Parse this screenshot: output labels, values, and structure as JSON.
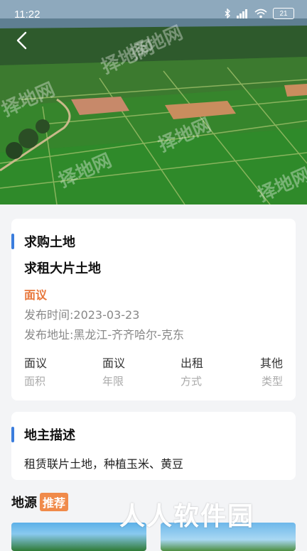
{
  "status_bar": {
    "time": "11:22",
    "battery": "21",
    "icons": [
      "bluetooth-icon",
      "signal-icon",
      "wifi-icon",
      "battery-icon"
    ]
  },
  "hero": {
    "watermark_text": "择地网",
    "image_description_icon": "farmland-photo"
  },
  "nav": {
    "back_icon": "back-arrow-icon"
  },
  "listing": {
    "section_title": "求购土地",
    "title": "求租大片土地",
    "price": "面议",
    "publish_time": "发布时间:2023-03-23",
    "publish_location": "发布地址:黑龙江-齐齐哈尔-克东",
    "stats": [
      {
        "value": "面议",
        "label": "面积"
      },
      {
        "value": "面议",
        "label": "年限"
      },
      {
        "value": "出租",
        "label": "方式"
      },
      {
        "value": "其他",
        "label": "类型"
      }
    ]
  },
  "owner": {
    "section_title": "地主描述",
    "description": "租赁联片土地，种植玉米、黄豆"
  },
  "source": {
    "title": "地源",
    "badge": "推荐"
  },
  "overlay_watermark": "人人软件园",
  "colors": {
    "accent_blue": "#3b7ddd",
    "price_orange": "#e8763a",
    "badge_orange": "#f08a4a"
  }
}
